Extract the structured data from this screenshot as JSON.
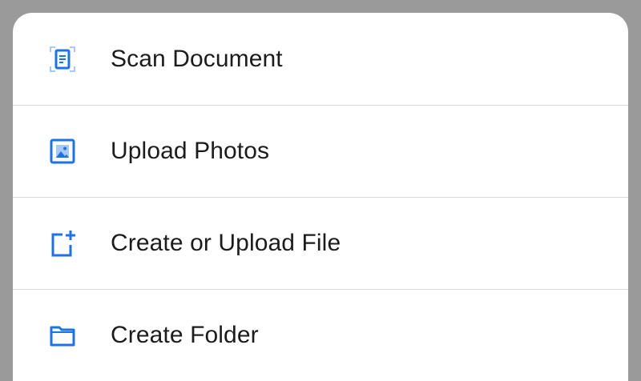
{
  "menu": {
    "items": [
      {
        "label": "Scan Document",
        "icon": "scan-document-icon"
      },
      {
        "label": "Upload Photos",
        "icon": "photo-icon"
      },
      {
        "label": "Create or Upload File",
        "icon": "new-file-icon"
      },
      {
        "label": "Create Folder",
        "icon": "folder-icon"
      }
    ]
  },
  "colors": {
    "accent": "#1a73e8",
    "accent_light": "#a8c8f5",
    "text": "#1c1c1e",
    "divider": "#d9d9dd",
    "backdrop": "#9a9a9a"
  }
}
